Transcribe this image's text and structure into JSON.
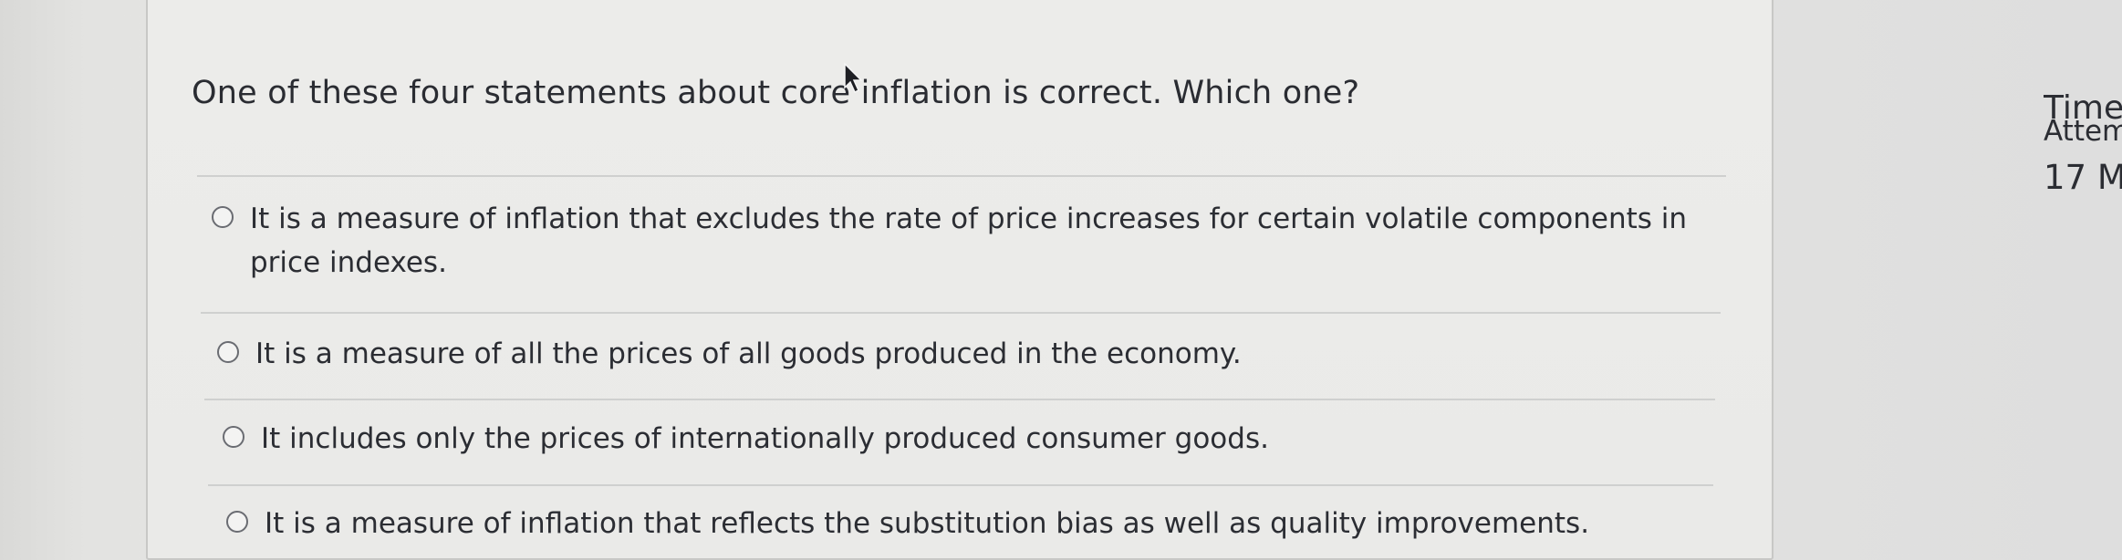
{
  "question": {
    "text": "One of these four statements about core inflation is correct. Which one?",
    "options": [
      {
        "label": "It is a measure of inflation that excludes the rate of price increases for certain volatile components in price indexes."
      },
      {
        "label": "It is a measure of all the prices of all goods produced in the economy."
      },
      {
        "label": "It includes only the prices of internationally produced consumer goods."
      },
      {
        "label": "It is a measure of inflation that reflects the substitution bias as well as quality improvements."
      }
    ]
  },
  "side_panel": {
    "time_label": "Time",
    "attempt_label": "Attem",
    "count_text": "17 M"
  },
  "icons": {
    "radio": "radio-unchecked-icon",
    "cursor": "mouse-pointer-icon"
  },
  "colors": {
    "card_background": "#ebebe9",
    "page_background": "#e2e2e0",
    "text": "#2b2d33"
  }
}
